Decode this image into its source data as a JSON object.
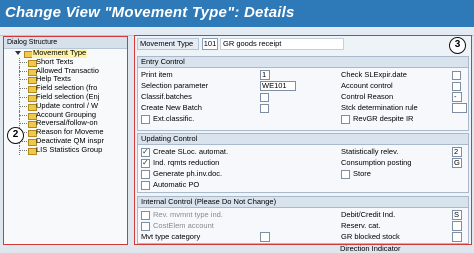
{
  "window": {
    "title": "Change View \"Movement Type\": Details"
  },
  "left_panel": {
    "header": "Dialog Structure",
    "root": "Movement Type",
    "items": [
      "Short Texts",
      "Allowed Transactio",
      "Help Texts",
      "Field selection (fro",
      "Field selection (Enj",
      "Update control / W",
      "Account Grouping",
      "Reversal/follow-on",
      "Reason for Moveme",
      "Deactivate QM inspr",
      "LIS Statistics Group"
    ]
  },
  "callouts": {
    "left": "2",
    "right": "3"
  },
  "header_fields": {
    "label": "Movement Type",
    "value": "101",
    "desc": "GR goods receipt"
  },
  "entry_control": {
    "title": "Entry Control",
    "print_item": {
      "label": "Print item",
      "value": "1"
    },
    "selection_parameter": {
      "label": "Selection parameter",
      "value": "WE101"
    },
    "classif_batches": {
      "label": "Classif.batches",
      "checked": false
    },
    "create_new_batch": {
      "label": "Create New Batch",
      "checked": false
    },
    "ext_classific": {
      "label": "Ext.classific.",
      "checked": false
    },
    "check_slexpr": {
      "label": "Check SLExpir.date",
      "checked": false
    },
    "account_control": {
      "label": "Account control",
      "checked": false
    },
    "control_reason": {
      "label": "Control Reason",
      "value": "-"
    },
    "stck_determination": {
      "label": "Stck determination rule",
      "value": ""
    },
    "revgr_despite_ir": {
      "label": "RevGR despite IR",
      "checked": false
    }
  },
  "updating_control": {
    "title": "Updating Control",
    "create_sloc": {
      "label": "Create SLoc. automat.",
      "checked": true
    },
    "ind_rqmts": {
      "label": "Ind. rqmts reduction",
      "checked": true
    },
    "generate_phinv": {
      "label": "Generate ph.inv.doc.",
      "checked": false
    },
    "automatic_po": {
      "label": "Automatic PO",
      "checked": false
    },
    "statistically_relev": {
      "label": "Statistically relev.",
      "value": "2"
    },
    "consumption_posting": {
      "label": "Consumption posting",
      "value": "G"
    },
    "store": {
      "label": "Store",
      "checked": false
    }
  },
  "internal_control": {
    "title": "Internal Control (Please Do Not Change)",
    "rev_mvmnt_type": {
      "label": "Rev. mvmnt type ind.",
      "checked": false
    },
    "costelem_account": {
      "label": "CostElem account",
      "checked": false
    },
    "mvt_type_category": {
      "label": "Mvt type category",
      "value": ""
    },
    "debit_credit": {
      "label": "Debit/Credit Ind.",
      "value": "S"
    },
    "reserv_cat": {
      "label": "Reserv. cat.",
      "value": ""
    },
    "gr_blocked_stock": {
      "label": "GR blocked stock",
      "value": ""
    },
    "direction_indicator": {
      "label": "Direction Indicator",
      "value": ""
    }
  },
  "colors": {
    "title_bar": "#2e79b8",
    "callout_border": "#d23a3a",
    "root_highlight": "#fff3a8"
  }
}
